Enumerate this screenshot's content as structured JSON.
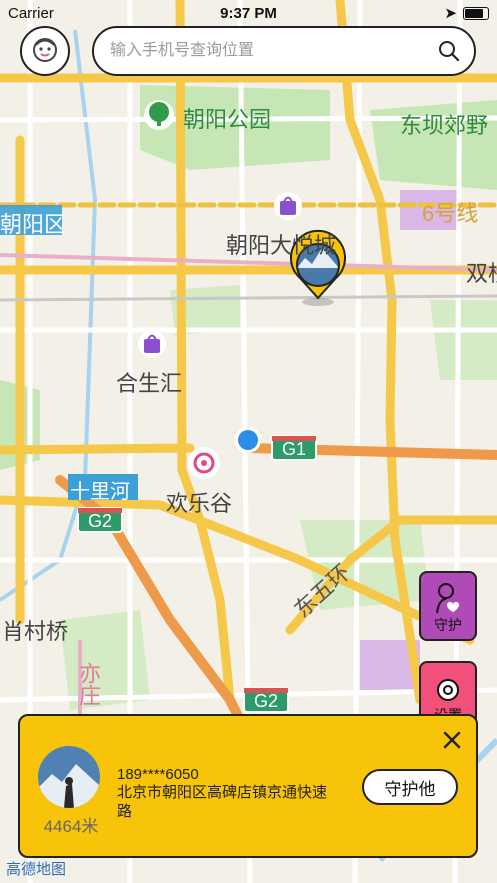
{
  "status_bar": {
    "carrier": "Carrier",
    "time": "9:37 PM"
  },
  "search": {
    "placeholder": "输入手机号查询位置"
  },
  "map": {
    "labels": {
      "chaoyang_park": "朝阳公园",
      "dongba": "东坝郊野",
      "line6": "6号线",
      "chaoyang_district": "朝阳区",
      "chaoyang_joy_city": "朝阳大悦城",
      "shuangqiao": "双桥",
      "hesheng": "合生汇",
      "shilihe": "十里河",
      "happy_valley": "欢乐谷",
      "g1": "G1",
      "g2_top": "G2",
      "g2_bottom": "G2",
      "east_fifth_ring": "东五环",
      "xiaocun": "肖村桥",
      "yizhuang": "亦庄"
    },
    "colors": {
      "road_major": "#f2c94c",
      "road_highway": "#ee9a4a",
      "park": "#bfe3b0",
      "water": "#9fd0f0"
    }
  },
  "side_buttons": {
    "guard_label": "守护",
    "settings_label": "设置"
  },
  "panel": {
    "phone": "189****6050",
    "address": "北京市朝阳区高碑店镇京通快速路",
    "distance": "4464米",
    "guard_button": "守护他"
  },
  "map_logo": "高德地图"
}
